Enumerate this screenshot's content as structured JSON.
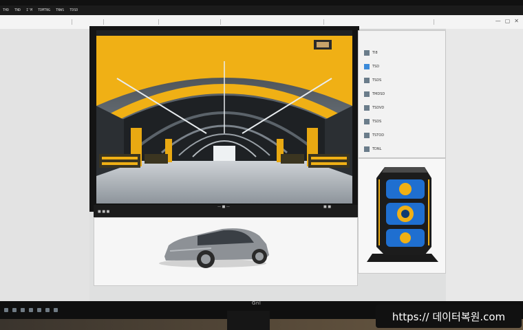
{
  "app": {
    "topbar_items": [
      "THD",
      "TND",
      "I'M",
      "TDMTNG",
      "TNWS",
      "TDSD"
    ],
    "window_controls": [
      "minimize-icon",
      "maximize-icon",
      "close-icon"
    ]
  },
  "viewport": {
    "scene": "warehouse-arch-render",
    "status_left": "■ ■ ■",
    "status_mid": "— ■ —",
    "status_right": "■ ■"
  },
  "layers_panel": {
    "rows": [
      {
        "label": "Tl8",
        "icon": "layer-icon"
      },
      {
        "label": "TSD",
        "icon": "layer-icon"
      },
      {
        "label": "TSDS",
        "icon": "layer-icon"
      },
      {
        "label": "TMDSD",
        "icon": "layer-icon"
      },
      {
        "label": "TSDVD",
        "icon": "layer-icon"
      },
      {
        "label": "TSDS",
        "icon": "layer-icon"
      },
      {
        "label": "TSTOD",
        "icon": "layer-icon"
      },
      {
        "label": "TDNL",
        "icon": "layer-icon"
      }
    ]
  },
  "assets": {
    "car": {
      "name": "car-model"
    },
    "product": {
      "name": "speaker-tower-model"
    }
  },
  "monitor": {
    "brand": "Gnl"
  },
  "watermark": {
    "text": "https:// 데이터복원.com"
  },
  "colors": {
    "accent_yellow": "#f0b015",
    "ui_bg": "#dfe0e0",
    "panel_bg": "#f2f2f2",
    "dark": "#141414",
    "product_blue": "#1f6fd0"
  }
}
